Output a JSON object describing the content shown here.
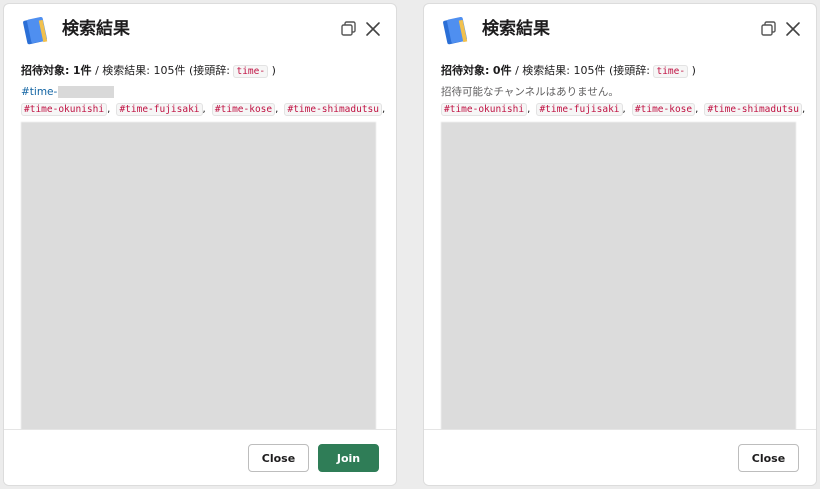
{
  "dialogs": [
    {
      "title": "検索結果",
      "summary": {
        "target_label": "招待対象:",
        "target_count": "1件",
        "divider": "/",
        "search_results": "検索結果: 105件",
        "prefix_open": "(接頭辞:",
        "prefix_code": "time-",
        "prefix_close": ")"
      },
      "invite_channel": "#time-",
      "channels": [
        "#time-okunishi",
        "#time-fujisaki",
        "#time-kose",
        "#time-shimadutsu"
      ],
      "buttons": {
        "close": "Close",
        "join": "Join"
      }
    },
    {
      "title": "検索結果",
      "summary": {
        "target_label": "招待対象:",
        "target_count": "0件",
        "divider": "/",
        "search_results": "検索結果: 105件",
        "prefix_open": "(接頭辞:",
        "prefix_code": "time-",
        "prefix_close": ")"
      },
      "empty_message": "招待可能なチャンネルはありません。",
      "channels": [
        "#time-okunishi",
        "#time-fujisaki",
        "#time-kose",
        "#time-shimadutsu"
      ],
      "buttons": {
        "close": "Close"
      }
    }
  ],
  "icons": {
    "app": "notebook-icon",
    "copy": "copy-icon",
    "close": "close-icon"
  },
  "colors": {
    "join_button": "#2f7d57",
    "code_text": "#c01343",
    "link": "#1264a3"
  }
}
